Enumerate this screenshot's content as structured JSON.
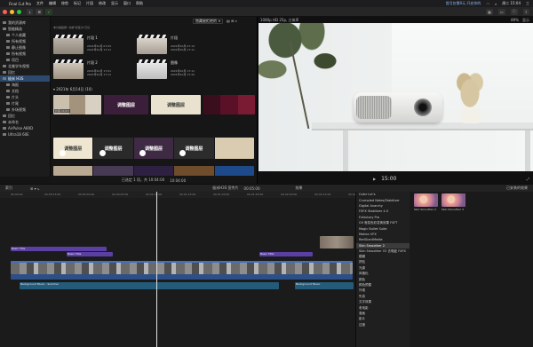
{
  "menubar": {
    "apple": "",
    "items": [
      "Final Cut Pro",
      "文件",
      "编辑",
      "修剪",
      "标记",
      "片段",
      "修改",
      "显示",
      "窗口",
      "帮助"
    ],
    "status_text": "首月仅需0元 开启你的",
    "clock": "周二 15:04",
    "user": "三"
  },
  "toolbar": {
    "window_dots": [
      "#ff5f57",
      "#febc2e",
      "#28c840"
    ],
    "download_label": "↓",
    "key_label": "⌘",
    "check_label": "✓"
  },
  "sidebar": {
    "items": [
      {
        "label": "我的资源库",
        "level": 0
      },
      {
        "label": "智能精选",
        "level": 0
      },
      {
        "label": "个人收藏",
        "level": 1
      },
      {
        "label": "所有视频",
        "level": 1
      },
      {
        "label": "静止图像",
        "level": 1
      },
      {
        "label": "所有视频",
        "level": 1
      },
      {
        "label": "项目",
        "level": 1
      },
      {
        "label": "北美学车视频",
        "level": 0
      },
      {
        "label": "回忆",
        "level": 0
      },
      {
        "label": "极米 H3S",
        "level": 0,
        "selected": true
      },
      {
        "label": "海报",
        "level": 1
      },
      {
        "label": "文档",
        "level": 1
      },
      {
        "label": "片头",
        "level": 1
      },
      {
        "label": "片尾",
        "level": 1
      },
      {
        "label": "外场视频",
        "level": 1
      },
      {
        "label": "回忆",
        "level": 0
      },
      {
        "label": "未命名",
        "level": 0
      },
      {
        "label": "AirPulse A80D",
        "level": 0
      },
      {
        "label": "Ultra18 60E",
        "level": 0
      }
    ]
  },
  "browser": {
    "filter": "隐藏被拒绝的",
    "icons": "▤ ⊞ ⌕",
    "tip": "未分组截屏 \"北桥\"标签为\"己识",
    "clips": [
      {
        "name": "片段 1",
        "meta1": "2021年10月 07:03",
        "meta2": "2021年10月 17:11"
      },
      {
        "name": "片段",
        "meta1": "2021年10月 07:13",
        "meta2": "2021年10月 17:11"
      },
      {
        "name": "片段 2",
        "meta1": "2021年10月 17:01",
        "meta2": "2021年10月 17:11"
      },
      {
        "name": "图像",
        "meta1": "2021年10月 17:11",
        "meta2": "2021年10月 17:22"
      }
    ],
    "date_group": "2021年 6月14日",
    "group_count": "(10)",
    "row1_labels": [
      "片尾 11/13",
      "",
      "",
      ""
    ],
    "row2_labels": [
      "调整图层",
      "调整图层",
      "调整图层",
      "调整图层"
    ],
    "row2_sub": [
      "北欧精",
      "北欧精",
      "北欧精",
      "北欧精"
    ],
    "foot_selected": "已选定 1 项，共 10:04:00",
    "foot_time": "10:04:00"
  },
  "viewer": {
    "format": "1080p HD 25p, 立体声",
    "zoom": "89%",
    "view": "显示",
    "timecode": "15:00",
    "fullscreen": "⤢"
  },
  "timeline_bar": {
    "index": "索引",
    "project": "极米H3S 宣传片",
    "duration": "00:05:00",
    "effects": "效果",
    "installed": "已安装的效果"
  },
  "timeline": {
    "ruler_marks": [
      "00:00:00",
      "00:00:15:00",
      "00:00:30:00",
      "00:00:45:00",
      "00:01:00:00",
      "00:01:15:00",
      "00:01:30:00",
      "00:01:45:00",
      "00:02:00:00",
      "00:02:15:00",
      "00:02:30:00"
    ],
    "title_clips": [
      "Basic Title",
      "Basic Title",
      "Basic Title"
    ],
    "audio_labels": [
      "Background Music - Summer",
      "Background Music"
    ]
  },
  "effects": {
    "list": [
      "Color Lut's",
      "Crumpled Notes/Stabilizer",
      "Digital Anarchy",
      "FXFX Stabilizer 4.0",
      "Fxfactory Pro",
      "Gif 渐变色彩变换效果 FSFT",
      "Magic Bullet Suite",
      "Motion VFX",
      "RedGiantMedia",
      "Skin Smoother 2",
      "Skin Smoother V3 去瑕疵 FXFX",
      "模糊",
      "拼贴",
      "光源",
      "风格化",
      "颜色",
      "颜色预置",
      "外观",
      "失真",
      "文字效果",
      "老电影",
      "漫画",
      "影片",
      "过渡"
    ],
    "selected_index": 9,
    "thumbs": [
      {
        "label": "Skin Smoother 2"
      },
      {
        "label": "Skin Smoother 3"
      }
    ]
  }
}
